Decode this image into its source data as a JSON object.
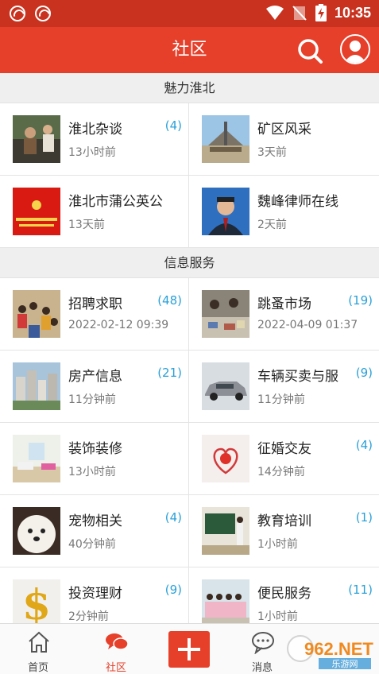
{
  "status_bar": {
    "time": "10:35"
  },
  "header": {
    "title": "社区"
  },
  "sections": [
    {
      "title": "魅力淮北",
      "items": [
        {
          "title": "淮北杂谈",
          "count": "(4)",
          "time": "13小时前"
        },
        {
          "title": "矿区风采",
          "count": "",
          "time": "3天前"
        },
        {
          "title": "淮北市蒲公英公",
          "count": "",
          "time": "13天前"
        },
        {
          "title": "魏峰律师在线",
          "count": "",
          "time": "2天前"
        }
      ]
    },
    {
      "title": "信息服务",
      "items": [
        {
          "title": "招聘求职",
          "count": "(48)",
          "time": "2022-02-12 09:39"
        },
        {
          "title": "跳蚤市场",
          "count": "(19)",
          "time": "2022-04-09 01:37"
        },
        {
          "title": "房产信息",
          "count": "(21)",
          "time": "11分钟前"
        },
        {
          "title": "车辆买卖与服",
          "count": "(9)",
          "time": "11分钟前"
        },
        {
          "title": "装饰装修",
          "count": "",
          "time": "13小时前"
        },
        {
          "title": "征婚交友",
          "count": "(4)",
          "time": "14分钟前"
        },
        {
          "title": "宠物相关",
          "count": "(4)",
          "time": "40分钟前"
        },
        {
          "title": "教育培训",
          "count": "(1)",
          "time": "1小时前"
        },
        {
          "title": "投资理财",
          "count": "(9)",
          "time": "2分钟前"
        },
        {
          "title": "便民服务",
          "count": "(11)",
          "time": "1小时前"
        }
      ]
    }
  ],
  "tabbar": {
    "home": "首页",
    "community": "社区",
    "messages": "消息"
  },
  "watermark": {
    "text": "962.NET",
    "subtext": "乐游网"
  },
  "colors": {
    "brand": "#e6402b",
    "count": "#2aa0d8"
  }
}
